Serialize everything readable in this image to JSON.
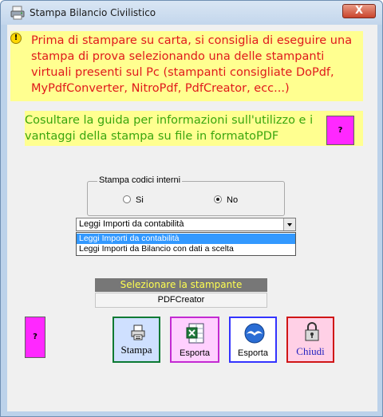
{
  "window": {
    "title": "Stampa Bilancio Civilistico",
    "close_glyph": "X"
  },
  "notice": {
    "warning_text": "Prima di stampare su carta, si consiglia di eseguire una stampa di prova selezionando una delle stampanti virtuali presenti sul Pc  (stampanti consigliate DoPdf, MyPdfConverter, NitroPdf, PdfCreator, ecc...)",
    "guide_text": "Cosultare la guida per  informazioni sull'utilizzo e i vantaggi della stampa su file in formatoPDF",
    "help_label": "?"
  },
  "internal_codes": {
    "legend": "Stampa codici interni",
    "options": [
      {
        "label": "Si",
        "checked": false
      },
      {
        "label": "No",
        "checked": true
      }
    ]
  },
  "import_source": {
    "selected": "Leggi Importi da contabilità",
    "options": [
      {
        "label": "Leggi Importi da contabilità",
        "highlighted": true
      },
      {
        "label": "Leggi Importi da Bilancio con dati a scelta",
        "highlighted": false
      }
    ]
  },
  "printer": {
    "header": "Selezionare la stampante",
    "value": "PDFCreator"
  },
  "actions": {
    "help_label": "?",
    "stampa": "Stampa",
    "esporta_excel": "Esporta",
    "esporta_pdf": "Esporta",
    "chiudi": "Chiudi"
  },
  "colors": {
    "warning_text": "#e0191b",
    "guide_text": "#3aa60e",
    "note_bg": "#ffff90",
    "help_bg": "#ff28ff",
    "printer_header_text": "#ffff50"
  }
}
